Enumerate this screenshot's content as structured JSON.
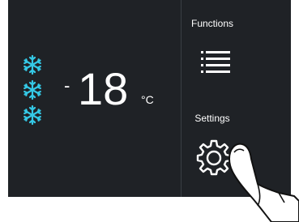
{
  "display": {
    "temperature_sign": "-",
    "temperature_value": "18",
    "temperature_unit": "°C"
  },
  "sidebar": {
    "functions_label": "Functions",
    "settings_label": "Settings"
  },
  "icons": {
    "snowflake": "snowflake-icon",
    "menu": "hamburger-menu-icon",
    "settings": "gear-icon",
    "pointer": "hand-pointer-icon"
  },
  "colors": {
    "panel_background": "#1f2226",
    "snowflake": "#35c9e6",
    "text": "#ffffff"
  }
}
